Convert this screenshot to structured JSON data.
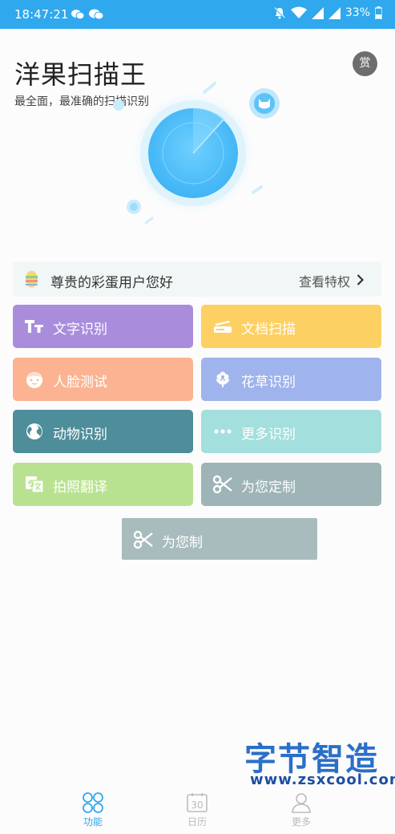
{
  "status_bar": {
    "time": "18:47:21",
    "battery": "33%",
    "color": "#2fa8ee",
    "icons": [
      "wechat-icon",
      "wechat-icon",
      "mute-icon",
      "wifi-icon",
      "signal-icon",
      "signal-icon",
      "battery-icon"
    ]
  },
  "header": {
    "title": "洋果扫描王",
    "subtitle": "最全面，最准确的扫描识别",
    "reward_label": "赏"
  },
  "vip": {
    "greeting": "尊贵的彩蛋用户您好",
    "link": "查看特权"
  },
  "tiles": [
    {
      "label": "文字识别",
      "icon": "text-tt-icon",
      "color": "#a98ddc"
    },
    {
      "label": "文档扫描",
      "icon": "scanner-icon",
      "color": "#fdd064"
    },
    {
      "label": "人脸测试",
      "icon": "face-icon",
      "color": "#fbb392"
    },
    {
      "label": "花草识别",
      "icon": "flower-icon",
      "color": "#9fb3ec"
    },
    {
      "label": "动物识别",
      "icon": "globe-icon",
      "color": "#4e8d9a"
    },
    {
      "label": "更多识别",
      "icon": "more-dots-icon",
      "color": "#a3dfdc"
    },
    {
      "label": "拍照翻译",
      "icon": "translate-icon",
      "color": "#b9e290"
    },
    {
      "label": "为您定制",
      "icon": "scissors-icon",
      "color": "#9eb4b7"
    }
  ],
  "drag_ghost": {
    "label": "为您制",
    "icon": "scissors-icon",
    "color": "#a9bcbd"
  },
  "bottom_nav": [
    {
      "label": "功能",
      "icon": "grid-circles-icon",
      "active": true
    },
    {
      "label": "日历",
      "icon": "calendar-icon",
      "calendar_day": "30",
      "active": false
    },
    {
      "label": "更多",
      "icon": "person-icon",
      "active": false
    }
  ],
  "nav_colors": {
    "active": "#2fa8ee",
    "inactive": "#bbbbbb"
  },
  "watermark": {
    "text": "字节智造",
    "url": "www.zsxcool.com"
  }
}
